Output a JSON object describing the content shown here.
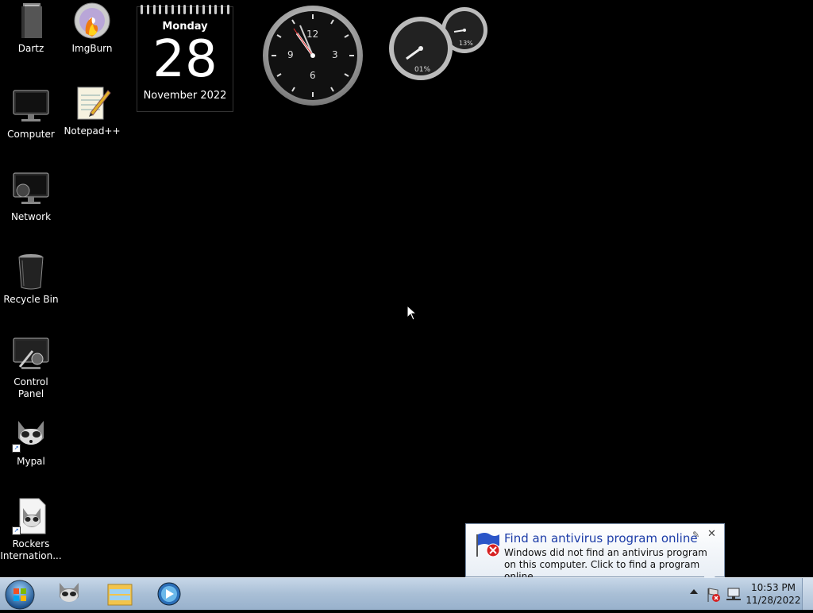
{
  "desktop": {
    "icons": [
      {
        "label": "Dartz",
        "icon": "folder-icon"
      },
      {
        "label": "ImgBurn",
        "icon": "imgburn-icon"
      },
      {
        "label": "Computer",
        "icon": "computer-icon"
      },
      {
        "label": "Notepad++",
        "icon": "notepad-icon"
      },
      {
        "label": "Network",
        "icon": "network-icon"
      },
      {
        "label": "Recycle Bin",
        "icon": "recycle-bin-icon"
      },
      {
        "label": "Control Panel",
        "icon": "control-panel-icon"
      },
      {
        "label": "Mypal",
        "icon": "raccoon-icon"
      },
      {
        "label": "Rockers\nInternation...",
        "icon": "raccoon-document-icon"
      }
    ]
  },
  "gadgets": {
    "calendar": {
      "weekday": "Monday",
      "day": "28",
      "month_year": "November 2022"
    },
    "clock": {
      "numerals": [
        "12",
        "3",
        "6",
        "9"
      ]
    },
    "cpu_meter": {
      "cpu": "01%",
      "memory": "13%"
    }
  },
  "notification": {
    "title": "Find an antivirus program online",
    "message": "Windows did not find an antivirus program on this computer. Click to find a program online.",
    "close": "✕",
    "pin": "✎"
  },
  "taskbar": {
    "pinned": [
      "raccoon-icon",
      "explorer-folder-icon",
      "media-icon"
    ],
    "clock_time": "10:53 PM",
    "clock_date": "11/28/2022"
  },
  "colors": {
    "desktop_bg": "#000000",
    "taskbar": "#a9bfd6",
    "balloon_title": "#1c3ca8"
  }
}
